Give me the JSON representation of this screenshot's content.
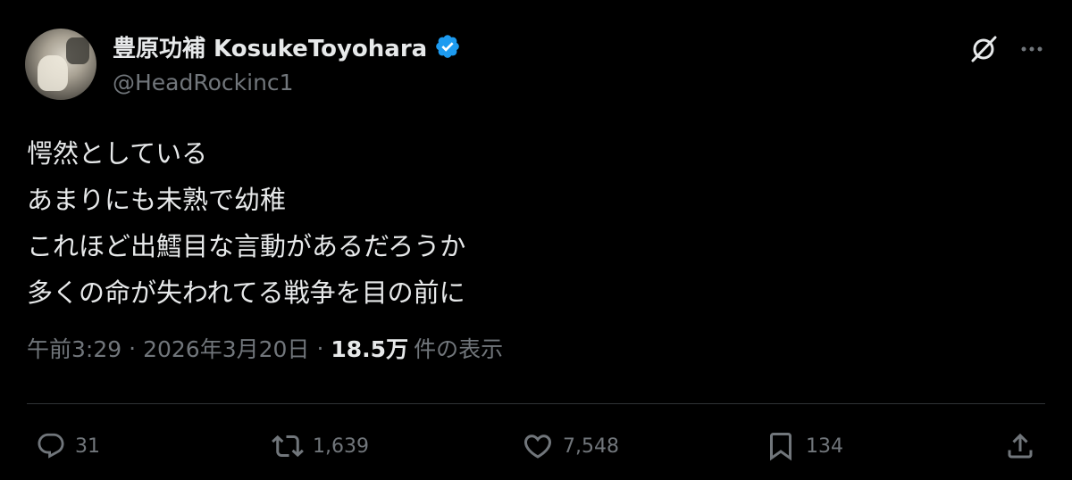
{
  "author": {
    "display_name": "豊原功補 KosukeToyohara",
    "handle": "@HeadRockinc1",
    "verified": true,
    "verified_color": "#1d9bf0"
  },
  "header_icons": [
    "grok-icon",
    "more-icon"
  ],
  "tweet": {
    "lines": [
      "愕然としている",
      "あまりにも未熟で幼稚",
      "これほど出鱈目な言動があるだろうか",
      "多くの命が失われてる戦争を目の前に"
    ]
  },
  "meta": {
    "time": "午前3:29",
    "separator": "·",
    "date": "2026年3月20日",
    "views_count": "18.5万",
    "views_label": "件の表示"
  },
  "actions": {
    "reply": {
      "icon": "reply-icon",
      "count": "31"
    },
    "retweet": {
      "icon": "retweet-icon",
      "count": "1,639"
    },
    "like": {
      "icon": "heart-icon",
      "count": "7,548"
    },
    "bookmark": {
      "icon": "bookmark-icon",
      "count": "134"
    },
    "share": {
      "icon": "share-icon"
    }
  }
}
